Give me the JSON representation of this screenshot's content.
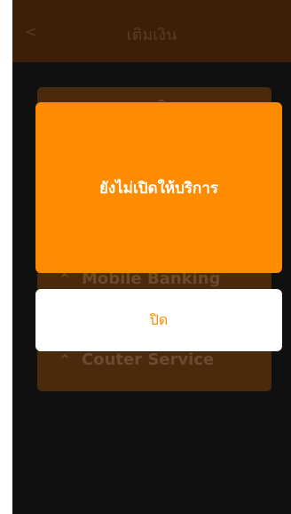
{
  "header": {
    "back_icon": "<",
    "title": "เติมเงิน"
  },
  "menu": {
    "items": [
      {
        "label": "Mobile Banking",
        "icon": "chevron-up-icon"
      },
      {
        "label": "Couter Service",
        "icon": "chevron-up-icon"
      }
    ]
  },
  "dialog": {
    "message": "ยังไม่เปิดให้บริการ",
    "close_label": "ปิด"
  },
  "colors": {
    "accent": "#ff8c00",
    "header_bg": "#3d1e08",
    "card_bg": "#4a2a0d",
    "screen_bg": "#101010",
    "button_bg": "#ffffff"
  }
}
